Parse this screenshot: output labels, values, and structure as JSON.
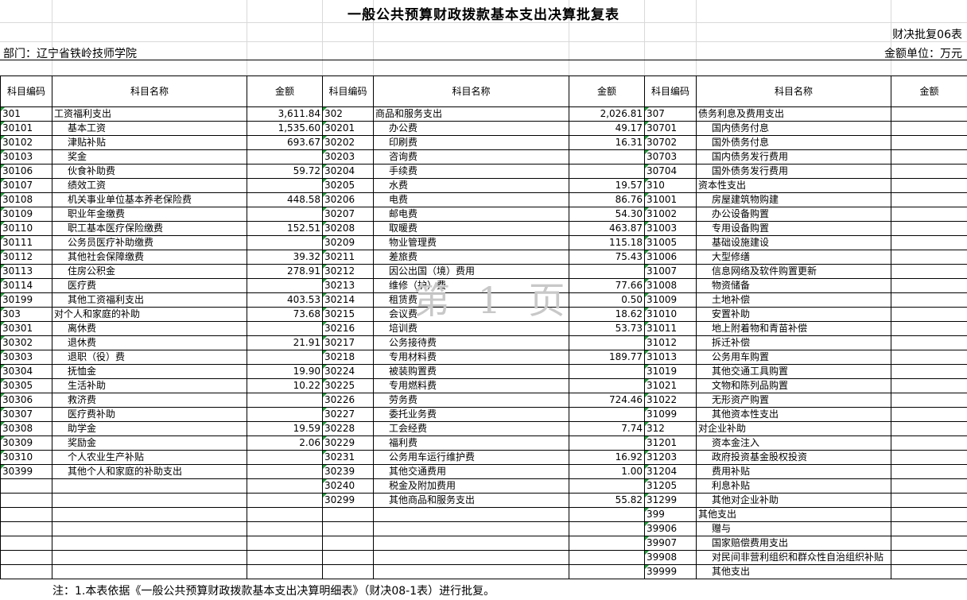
{
  "title": "一般公共预算财政拨款基本支出决算批复表",
  "form_code": "财决批复06表",
  "department": "部门：辽宁省铁岭技师学院",
  "unit": "金额单位：万元",
  "headers": [
    "科目编码",
    "科目名称",
    "金额",
    "科目编码",
    "科目名称",
    "金额",
    "科目编码",
    "科目名称",
    "金额"
  ],
  "rows": [
    {
      "c1": "301",
      "n1": "工资福利支出",
      "s1": false,
      "a1": "3,611.84",
      "c2": "302",
      "n2": "商品和服务支出",
      "s2": false,
      "a2": "2,026.81",
      "c3": "307",
      "n3": "债务利息及费用支出",
      "s3": false,
      "a3": ""
    },
    {
      "c1": "30101",
      "n1": "基本工资",
      "s1": true,
      "a1": "1,535.60",
      "c2": "30201",
      "n2": "办公费",
      "s2": true,
      "a2": "49.17",
      "c3": "30701",
      "n3": "国内债务付息",
      "s3": true,
      "a3": ""
    },
    {
      "c1": "30102",
      "n1": "津贴补贴",
      "s1": true,
      "a1": "693.67",
      "c2": "30202",
      "n2": "印刷费",
      "s2": true,
      "a2": "16.31",
      "c3": "30702",
      "n3": "国外债务付息",
      "s3": true,
      "a3": ""
    },
    {
      "c1": "30103",
      "n1": "奖金",
      "s1": true,
      "a1": "",
      "c2": "30203",
      "n2": "咨询费",
      "s2": true,
      "a2": "",
      "c3": "30703",
      "n3": "国内债务发行费用",
      "s3": true,
      "a3": ""
    },
    {
      "c1": "30106",
      "n1": "伙食补助费",
      "s1": true,
      "a1": "59.72",
      "c2": "30204",
      "n2": "手续费",
      "s2": true,
      "a2": "",
      "c3": "30704",
      "n3": "国外债务发行费用",
      "s3": true,
      "a3": ""
    },
    {
      "c1": "30107",
      "n1": "绩效工资",
      "s1": true,
      "a1": "",
      "c2": "30205",
      "n2": "水费",
      "s2": true,
      "a2": "19.57",
      "c3": "310",
      "n3": "资本性支出",
      "s3": false,
      "a3": ""
    },
    {
      "c1": "30108",
      "n1": "机关事业单位基本养老保险费",
      "s1": true,
      "a1": "448.58",
      "c2": "30206",
      "n2": "电费",
      "s2": true,
      "a2": "86.76",
      "c3": "31001",
      "n3": "房屋建筑物购建",
      "s3": true,
      "a3": ""
    },
    {
      "c1": "30109",
      "n1": "职业年金缴费",
      "s1": true,
      "a1": "",
      "c2": "30207",
      "n2": "邮电费",
      "s2": true,
      "a2": "54.30",
      "c3": "31002",
      "n3": "办公设备购置",
      "s3": true,
      "a3": ""
    },
    {
      "c1": "30110",
      "n1": "职工基本医疗保险缴费",
      "s1": true,
      "a1": "152.51",
      "c2": "30208",
      "n2": "取暖费",
      "s2": true,
      "a2": "463.87",
      "c3": "31003",
      "n3": "专用设备购置",
      "s3": true,
      "a3": ""
    },
    {
      "c1": "30111",
      "n1": "公务员医疗补助缴费",
      "s1": true,
      "a1": "",
      "c2": "30209",
      "n2": "物业管理费",
      "s2": true,
      "a2": "115.18",
      "c3": "31005",
      "n3": "基础设施建设",
      "s3": true,
      "a3": ""
    },
    {
      "c1": "30112",
      "n1": "其他社会保障缴费",
      "s1": true,
      "a1": "39.32",
      "c2": "30211",
      "n2": "差旅费",
      "s2": true,
      "a2": "75.43",
      "c3": "31006",
      "n3": "大型修缮",
      "s3": true,
      "a3": ""
    },
    {
      "c1": "30113",
      "n1": "住房公积金",
      "s1": true,
      "a1": "278.91",
      "c2": "30212",
      "n2": "因公出国（境）费用",
      "s2": true,
      "a2": "",
      "c3": "31007",
      "n3": "信息网络及软件购置更新",
      "s3": true,
      "a3": ""
    },
    {
      "c1": "30114",
      "n1": "医疗费",
      "s1": true,
      "a1": "",
      "c2": "30213",
      "n2": "维修（护）费",
      "s2": true,
      "a2": "77.66",
      "c3": "31008",
      "n3": "物资储备",
      "s3": true,
      "a3": ""
    },
    {
      "c1": "30199",
      "n1": "其他工资福利支出",
      "s1": true,
      "a1": "403.53",
      "c2": "30214",
      "n2": "租赁费",
      "s2": true,
      "a2": "0.50",
      "c3": "31009",
      "n3": "土地补偿",
      "s3": true,
      "a3": ""
    },
    {
      "c1": "303",
      "n1": "对个人和家庭的补助",
      "s1": false,
      "a1": "73.68",
      "c2": "30215",
      "n2": "会议费",
      "s2": true,
      "a2": "18.62",
      "c3": "31010",
      "n3": "安置补助",
      "s3": true,
      "a3": ""
    },
    {
      "c1": "30301",
      "n1": "离休费",
      "s1": true,
      "a1": "",
      "c2": "30216",
      "n2": "培训费",
      "s2": true,
      "a2": "53.73",
      "c3": "31011",
      "n3": "地上附着物和青苗补偿",
      "s3": true,
      "a3": ""
    },
    {
      "c1": "30302",
      "n1": "退休费",
      "s1": true,
      "a1": "21.91",
      "c2": "30217",
      "n2": "公务接待费",
      "s2": true,
      "a2": "",
      "c3": "31012",
      "n3": "拆迁补偿",
      "s3": true,
      "a3": ""
    },
    {
      "c1": "30303",
      "n1": "退职（役）费",
      "s1": true,
      "a1": "",
      "c2": "30218",
      "n2": "专用材料费",
      "s2": true,
      "a2": "189.77",
      "c3": "31013",
      "n3": "公务用车购置",
      "s3": true,
      "a3": ""
    },
    {
      "c1": "30304",
      "n1": "抚恤金",
      "s1": true,
      "a1": "19.90",
      "c2": "30224",
      "n2": "被装购置费",
      "s2": true,
      "a2": "",
      "c3": "31019",
      "n3": "其他交通工具购置",
      "s3": true,
      "a3": ""
    },
    {
      "c1": "30305",
      "n1": "生活补助",
      "s1": true,
      "a1": "10.22",
      "c2": "30225",
      "n2": "专用燃料费",
      "s2": true,
      "a2": "",
      "c3": "31021",
      "n3": "文物和陈列品购置",
      "s3": true,
      "a3": ""
    },
    {
      "c1": "30306",
      "n1": "救济费",
      "s1": true,
      "a1": "",
      "c2": "30226",
      "n2": "劳务费",
      "s2": true,
      "a2": "724.46",
      "c3": "31022",
      "n3": "无形资产购置",
      "s3": true,
      "a3": ""
    },
    {
      "c1": "30307",
      "n1": "医疗费补助",
      "s1": true,
      "a1": "",
      "c2": "30227",
      "n2": "委托业务费",
      "s2": true,
      "a2": "",
      "c3": "31099",
      "n3": "其他资本性支出",
      "s3": true,
      "a3": ""
    },
    {
      "c1": "30308",
      "n1": "助学金",
      "s1": true,
      "a1": "19.59",
      "c2": "30228",
      "n2": "工会经费",
      "s2": true,
      "a2": "7.74",
      "c3": "312",
      "n3": "对企业补助",
      "s3": false,
      "a3": ""
    },
    {
      "c1": "30309",
      "n1": "奖励金",
      "s1": true,
      "a1": "2.06",
      "c2": "30229",
      "n2": "福利费",
      "s2": true,
      "a2": "",
      "c3": "31201",
      "n3": "资本金注入",
      "s3": true,
      "a3": ""
    },
    {
      "c1": "30310",
      "n1": "个人农业生产补贴",
      "s1": true,
      "a1": "",
      "c2": "30231",
      "n2": "公务用车运行维护费",
      "s2": true,
      "a2": "16.92",
      "c3": "31203",
      "n3": "政府投资基金股权投资",
      "s3": true,
      "a3": ""
    },
    {
      "c1": "30399",
      "n1": "其他个人和家庭的补助支出",
      "s1": true,
      "a1": "",
      "c2": "30239",
      "n2": "其他交通费用",
      "s2": true,
      "a2": "1.00",
      "c3": "31204",
      "n3": "费用补贴",
      "s3": true,
      "a3": ""
    },
    {
      "c1": "",
      "n1": "",
      "s1": false,
      "a1": "",
      "c2": "30240",
      "n2": "税金及附加费用",
      "s2": true,
      "a2": "",
      "c3": "31205",
      "n3": "利息补贴",
      "s3": true,
      "a3": ""
    },
    {
      "c1": "",
      "n1": "",
      "s1": false,
      "a1": "",
      "c2": "30299",
      "n2": "其他商品和服务支出",
      "s2": true,
      "a2": "55.82",
      "c3": "31299",
      "n3": "其他对企业补助",
      "s3": true,
      "a3": ""
    },
    {
      "c1": "",
      "n1": "",
      "s1": false,
      "a1": "",
      "c2": "",
      "n2": "",
      "s2": false,
      "a2": "",
      "c3": "399",
      "n3": "其他支出",
      "s3": false,
      "a3": ""
    },
    {
      "c1": "",
      "n1": "",
      "s1": false,
      "a1": "",
      "c2": "",
      "n2": "",
      "s2": false,
      "a2": "",
      "c3": "39906",
      "n3": "赠与",
      "s3": true,
      "a3": ""
    },
    {
      "c1": "",
      "n1": "",
      "s1": false,
      "a1": "",
      "c2": "",
      "n2": "",
      "s2": false,
      "a2": "",
      "c3": "39907",
      "n3": "国家赔偿费用支出",
      "s3": true,
      "a3": ""
    },
    {
      "c1": "",
      "n1": "",
      "s1": false,
      "a1": "",
      "c2": "",
      "n2": "",
      "s2": false,
      "a2": "",
      "c3": "39908",
      "n3": "对民间非营利组织和群众性自治组织补贴",
      "s3": true,
      "a3": ""
    },
    {
      "c1": "",
      "n1": "",
      "s1": false,
      "a1": "",
      "c2": "",
      "n2": "",
      "s2": false,
      "a2": "",
      "c3": "39999",
      "n3": "其他支出",
      "s3": true,
      "a3": ""
    }
  ],
  "note": "注：1.本表依据《一般公共预算财政拨款基本支出决算明细表》（财决08-1表）进行批复。",
  "watermark": "第 1 页"
}
